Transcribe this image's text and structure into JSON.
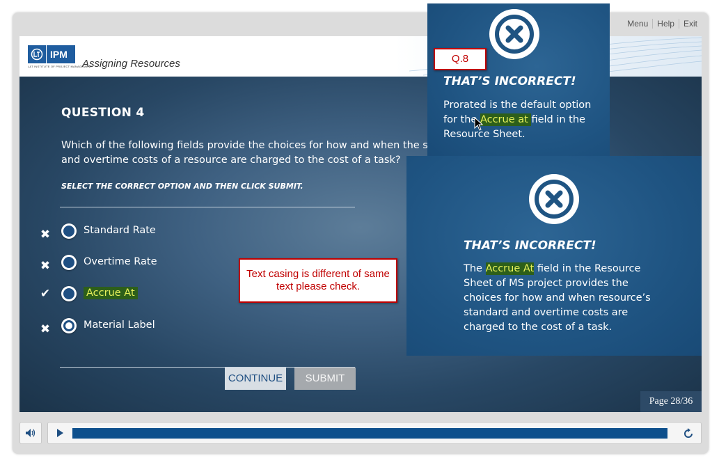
{
  "top_menu": {
    "menu": "Menu",
    "help": "Help",
    "exit": "Exit"
  },
  "header": {
    "logo_text": "IPM",
    "logo_subtext": "L&T INSTITUTE OF PROJECT MANAGEMENT",
    "course_title": "Assigning Resources"
  },
  "question": {
    "title": "QUESTION 4",
    "text_line1": "Which of the following fields provide the choices for how and when the standard",
    "text_line2": "and overtime costs of a resource are charged to the cost of a task?",
    "instruction": "SELECT THE CORRECT OPTION AND THEN CLICK SUBMIT.",
    "options": [
      {
        "label": "Standard Rate",
        "mark": "✖",
        "selected": false,
        "highlighted": false
      },
      {
        "label": "Overtime Rate",
        "mark": "✖",
        "selected": false,
        "highlighted": false
      },
      {
        "label": "Accrue At",
        "mark": "✔",
        "selected": false,
        "highlighted": true
      },
      {
        "label": "Material Label",
        "mark": "✖",
        "selected": true,
        "highlighted": false
      }
    ]
  },
  "buttons": {
    "continue": "CONTINUE",
    "submit": "SUBMIT"
  },
  "page": {
    "label": "Page 28/36",
    "current": 28,
    "total": 36
  },
  "player": {
    "progress_percent": 100
  },
  "feedback_small": {
    "title": "THAT’S INCORRECT!",
    "line1": "Prorated is the default option",
    "line2_pre": "for the ",
    "line2_hl": "Accrue at ",
    "line2_post": "field in the",
    "line3": "Resource Sheet."
  },
  "feedback_large": {
    "title": "THAT’S INCORRECT!",
    "line1_pre": "The ",
    "line1_hl": "Accrue At",
    "line1_post": " field in the Resource",
    "line2": "Sheet of MS project provides the",
    "line3": "choices for how and when resource’s",
    "line4": "standard and overtime costs are",
    "line5": "charged to the cost of a task."
  },
  "review": {
    "question_tag": "Q.8",
    "note": "Text casing is different of same text please check."
  },
  "colors": {
    "brand_blue": "#1f5d9f",
    "feedback_bg": "#1f5482",
    "highlight_bg": "#2d5f1a",
    "highlight_text": "#e6f05a",
    "review_red": "#c00000",
    "progress_fill": "#0d4f8c"
  },
  "icons": {
    "logo": "lt-logo-icon",
    "wrong": "cross-icon",
    "right": "check-icon",
    "feedback": "incorrect-circle-icon",
    "volume": "speaker-icon",
    "play": "play-icon",
    "replay": "replay-icon",
    "cursor": "mouse-cursor-icon"
  }
}
